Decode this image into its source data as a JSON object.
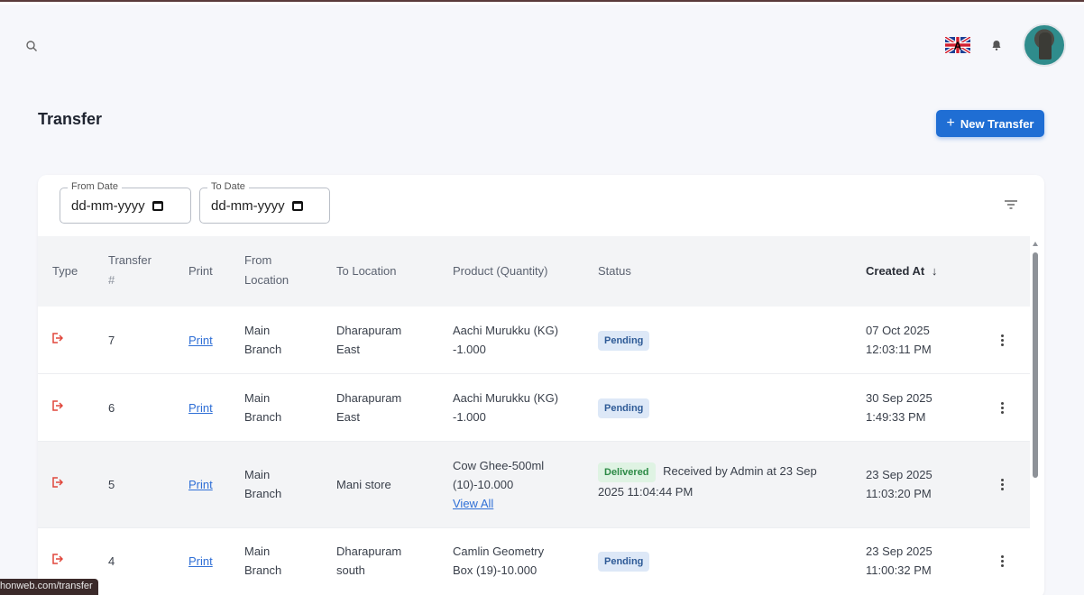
{
  "header": {
    "search_icon": "search-icon",
    "flag_icon": "uk-flag-icon",
    "bell_icon": "bell-icon"
  },
  "page": {
    "title": "Transfer",
    "new_button_label": "New Transfer"
  },
  "filters": {
    "from_date_label": "From Date",
    "from_date_value": "dd-mm-yyyy",
    "to_date_label": "To Date",
    "to_date_value": "dd-mm-yyyy"
  },
  "table": {
    "columns": {
      "type": "Type",
      "transfer_1": "Transfer",
      "transfer_2": "#",
      "print": "Print",
      "from_1": "From",
      "from_2": "Location",
      "to": "To Location",
      "product": "Product (Quantity)",
      "status": "Status",
      "created": "Created At",
      "sort_arrow": "↓"
    },
    "rows": [
      {
        "id": "7",
        "print": "Print",
        "from_1": "Main",
        "from_2": "Branch",
        "to_1": "Dharapuram",
        "to_2": "East",
        "product_1": "Aachi Murukku (KG)",
        "product_2": "-1.000",
        "product_3": "",
        "status": "Pending",
        "status_note_1": "",
        "status_note_2": "",
        "date": "07 Oct 2025",
        "time": "12:03:11 PM"
      },
      {
        "id": "6",
        "print": "Print",
        "from_1": "Main",
        "from_2": "Branch",
        "to_1": "Dharapuram",
        "to_2": "East",
        "product_1": "Aachi Murukku (KG)",
        "product_2": "-1.000",
        "product_3": "",
        "status": "Pending",
        "status_note_1": "",
        "status_note_2": "",
        "date": "30 Sep 2025",
        "time": "1:49:33 PM"
      },
      {
        "id": "5",
        "print": "Print",
        "from_1": "Main",
        "from_2": "Branch",
        "to_1": "Mani store",
        "to_2": "",
        "product_1": "Cow Ghee-500ml",
        "product_2": "(10)-10.000",
        "product_3": "View All",
        "status": "Delivered",
        "status_note_1": "Received by Admin at 23 Sep",
        "status_note_2": "2025 11:04:44 PM",
        "date": "23 Sep 2025",
        "time": "11:03:20 PM"
      },
      {
        "id": "4",
        "print": "Print",
        "from_1": "Main",
        "from_2": "Branch",
        "to_1": "Dharapuram",
        "to_2": "south",
        "product_1": "Camlin Geometry",
        "product_2": "Box (19)-10.000",
        "product_3": "",
        "status": "Pending",
        "status_note_1": "",
        "status_note_2": "",
        "date": "23 Sep 2025",
        "time": "11:00:32 PM"
      }
    ]
  },
  "statusbar": {
    "url": "honweb.com/transfer"
  }
}
